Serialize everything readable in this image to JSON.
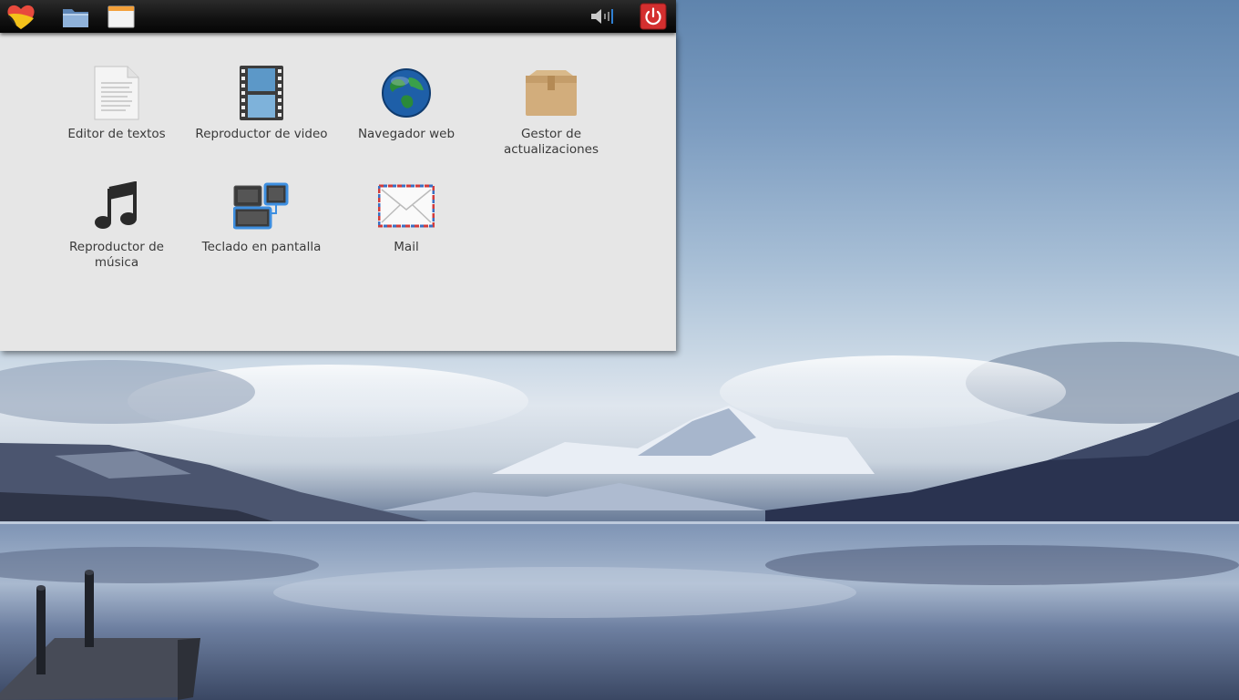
{
  "panel": {
    "menu_icon": "heart-logo-icon",
    "folder_icon": "folder-icon",
    "window_icon": "window-icon",
    "volume_icon": "volume-icon",
    "power_icon": "power-icon",
    "power_color": "#d42f2f"
  },
  "launcher": {
    "apps": [
      {
        "label": "Editor de textos",
        "icon": "text-editor-icon"
      },
      {
        "label": "Reproductor de video",
        "icon": "video-player-icon"
      },
      {
        "label": "Navegador web",
        "icon": "web-browser-icon"
      },
      {
        "label": "Gestor de actualizaciones",
        "icon": "update-manager-icon"
      },
      {
        "label": "Reproductor de música",
        "icon": "music-player-icon"
      },
      {
        "label": "Teclado en pantalla",
        "icon": "onscreen-keyboard-icon"
      },
      {
        "label": "Mail",
        "icon": "mail-icon"
      }
    ]
  }
}
